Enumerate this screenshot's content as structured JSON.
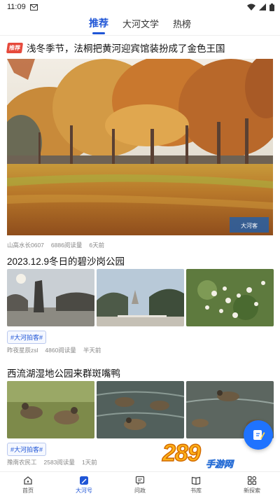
{
  "status_bar": {
    "time": "11:09",
    "icons": [
      "mail-icon",
      "wifi-icon",
      "signal-icon",
      "battery-icon"
    ]
  },
  "tabs": [
    {
      "label": "推荐",
      "active": true
    },
    {
      "label": "大河文学",
      "active": false
    },
    {
      "label": "热榜",
      "active": false
    }
  ],
  "articles": [
    {
      "badge": "推荐",
      "title": "浅冬季节，法桐把黄河迎宾馆装扮成了金色王国",
      "author": "山高水长0607",
      "reads": "6886阅读量",
      "time": "6天前"
    },
    {
      "title": "2023.12.9冬日的碧沙岗公园",
      "tag": "#大河拍客#",
      "author": "昨夜星辰zsl",
      "reads": "4860阅读量",
      "time": "半天前"
    },
    {
      "title": "西流湖湿地公园来群斑嘴鸭",
      "tag": "#大河拍客#",
      "author": "豫南农民工",
      "reads": "2583阅读量",
      "time": "1天前"
    }
  ],
  "bottom_nav": [
    {
      "label": "首页",
      "icon": "home-icon",
      "active": false
    },
    {
      "label": "大河号",
      "icon": "pen-icon",
      "active": true
    },
    {
      "label": "问政",
      "icon": "message-icon",
      "active": false
    },
    {
      "label": "书库",
      "icon": "book-icon",
      "active": false
    },
    {
      "label": "新探索",
      "icon": "grid-icon",
      "active": false
    }
  ],
  "watermark": {
    "number": "289",
    "text": "手游网"
  },
  "colors": {
    "accent": "#1f55d6",
    "hot_badge": "#e64a3c",
    "fab": "#1f73ff"
  }
}
